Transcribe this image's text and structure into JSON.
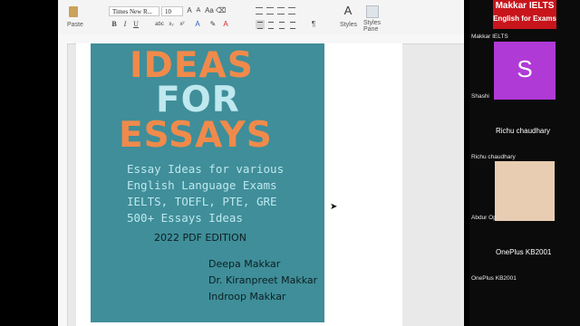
{
  "toolbar": {
    "paste_label": "Paste",
    "font_name": "Times New R...",
    "font_size": "10",
    "styles_label": "Styles",
    "styles_pane_label": "Styles Pane"
  },
  "book": {
    "title_line1": "IDEAS",
    "title_line2": "FOR",
    "title_line3": "ESSAYS",
    "subtitle": [
      "Essay Ideas for various",
      "English Language Exams",
      "IELTS, TOEFL, PTE, GRE",
      "500+ Essays Ideas"
    ],
    "edition": "2022 PDF EDITION",
    "authors": [
      "Deepa Makkar",
      "Dr. Kiranpreet Makkar",
      "Indroop Makkar"
    ]
  },
  "participants": [
    {
      "label": "Makkar IELTS",
      "logo_line1": "Makkar IELTS",
      "logo_line2": "English for Exams"
    },
    {
      "label": "Shashi",
      "initial": "S"
    },
    {
      "label": "Richu chaudhary",
      "center_name": "Richu chaudhary"
    },
    {
      "label": "Abdur Op"
    },
    {
      "label": "OnePlus KB2001",
      "center_name": "OnePlus KB2001"
    }
  ],
  "colors": {
    "cover": "#3f8e99",
    "orange": "#f08a4b",
    "light_blue": "#bfe8ef",
    "avatar_purple": "#b03ad6",
    "logo_red": "#c8141b"
  }
}
